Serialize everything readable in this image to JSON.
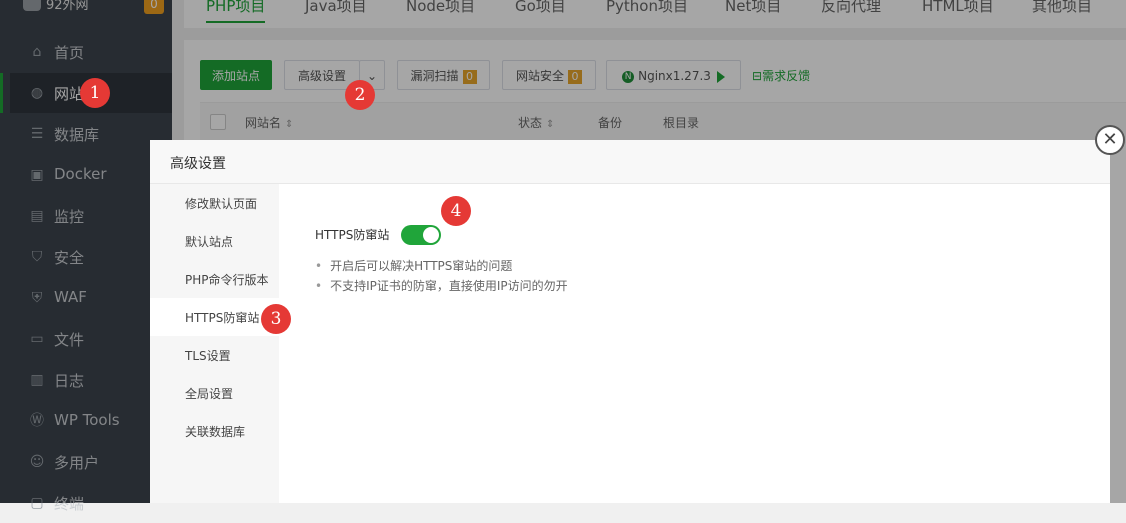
{
  "brand": {
    "name": "92外网",
    "count": "0"
  },
  "sidebar": {
    "items": [
      {
        "label": "首页",
        "icon": "home-icon",
        "glyph": "⌂"
      },
      {
        "label": "网站",
        "icon": "globe-icon",
        "glyph": "◍"
      },
      {
        "label": "数据库",
        "icon": "database-icon",
        "glyph": "☰"
      },
      {
        "label": "Docker",
        "icon": "docker-icon",
        "glyph": "▣"
      },
      {
        "label": "监控",
        "icon": "monitor-icon",
        "glyph": "▤"
      },
      {
        "label": "安全",
        "icon": "shield-icon",
        "glyph": "⛉"
      },
      {
        "label": "WAF",
        "icon": "waf-icon",
        "glyph": "⛨"
      },
      {
        "label": "文件",
        "icon": "folder-icon",
        "glyph": "▭"
      },
      {
        "label": "日志",
        "icon": "log-icon",
        "glyph": "▥"
      },
      {
        "label": "WP Tools",
        "icon": "wordpress-icon",
        "glyph": "Ⓦ"
      },
      {
        "label": "多用户",
        "icon": "users-icon",
        "glyph": "☺"
      },
      {
        "label": "终端",
        "icon": "terminal-icon",
        "glyph": "▢"
      }
    ]
  },
  "tabs": [
    "PHP项目",
    "Java项目",
    "Node项目",
    "Go项目",
    "Python项目",
    "Net项目",
    "反向代理",
    "HTML项目",
    "其他项目"
  ],
  "toolbar": {
    "add_site": "添加站点",
    "advanced": "高级设置",
    "vuln_scan": "漏洞扫描",
    "vuln_count": "0",
    "site_security": "网站安全",
    "security_count": "0",
    "nginx": "Nginx1.27.3",
    "feedback": "需求反馈"
  },
  "table": {
    "headers": {
      "name": "网站名",
      "status": "状态",
      "backup": "备份",
      "root": "根目录"
    }
  },
  "modal": {
    "title": "高级设置",
    "menu": [
      "修改默认页面",
      "默认站点",
      "PHP命令行版本",
      "HTTPS防窜站",
      "TLS设置",
      "全局设置",
      "关联数据库"
    ],
    "active_menu": "HTTPS防窜站",
    "setting_label": "HTTPS防窜站",
    "toggle_on": true,
    "tips": [
      "开启后可以解决HTTPS窜站的问题",
      "不支持IP证书的防窜，直接使用IP访问的勿开"
    ]
  },
  "steps": [
    "1",
    "2",
    "3",
    "4"
  ],
  "colors": {
    "accent": "#20a53a",
    "sidebar_bg": "#3c444d",
    "badge": "#e8a72b",
    "step_marker": "#e53935"
  }
}
